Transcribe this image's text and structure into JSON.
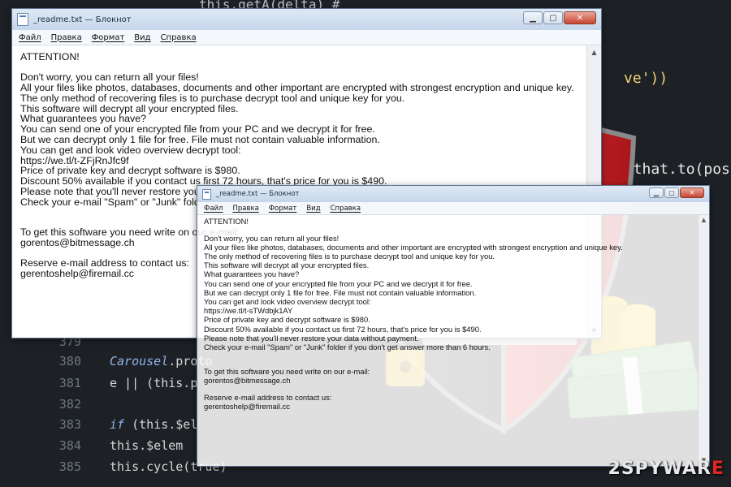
{
  "background_code": {
    "lines": [
      {
        "num": "379",
        "text": ""
      },
      {
        "num": "380",
        "text": "Carousel.proto"
      },
      {
        "num": "381",
        "text": "  e || (this.p"
      },
      {
        "num": "382",
        "text": ""
      },
      {
        "num": "383",
        "text": "  if (this.$el"
      },
      {
        "num": "384",
        "text": "    this.$elem"
      },
      {
        "num": "385",
        "text": "    this.cycle(true)"
      }
    ],
    "fragment_top": "this.getA(delta) #",
    "fragment_ve": "ve'))",
    "fragment_that": "{ that.to(pos) })"
  },
  "note_text": [
    "ATTENTION!",
    "",
    "Don't worry, you can return all your files!",
    "All your files like photos, databases, documents and other important are encrypted with strongest encryption and unique key.",
    "The only method of recovering files is to purchase decrypt tool and unique key for you.",
    "This software will decrypt all your encrypted files.",
    "What guarantees you have?",
    "You can send one of your encrypted file from your PC and we decrypt it for free.",
    "But we can decrypt only 1 file for free. File must not contain valuable information.",
    "You can get and look video overview decrypt tool:",
    "",
    "Price of private key and decrypt software is $980.",
    "Discount 50% available if you contact us first 72 hours, that's price for you is $490.",
    "Please note that you'll never restore your data without payment.",
    "Check your e-mail \"Spam\" or \"Junk\" folder if you don't get answer more than 6 hours.",
    "",
    "",
    "To get this software you need write on our e-mail:",
    "gorentos@bitmessage.ch",
    "",
    "Reserve e-mail address to contact us:",
    "gerentoshelp@firemail.cc"
  ],
  "window_back": {
    "title": "_readme.txt — Блокнот",
    "menu": [
      "Файл",
      "Правка",
      "Формат",
      "Вид",
      "Справка"
    ],
    "video_link": "https://we.tl/t-ZFjRnJfc9f"
  },
  "window_front": {
    "title": "_readme.txt — Блокнот",
    "menu": [
      "Файл",
      "Правка",
      "Формат",
      "Вид",
      "Справка"
    ],
    "video_link": "https://we.tl/t-sTWdbjk1AY"
  },
  "window_buttons": {
    "minimize": "▁",
    "maximize": "▢",
    "close": "✕"
  },
  "watermark": {
    "prefix": "2",
    "brand": "SPYWAR",
    "suffix": "E"
  },
  "colors": {
    "shield_red": "#d8222a",
    "shield_dark": "#2a2a2a",
    "coin_gold": "#f2c21b",
    "cash_green": "#6aa85a"
  }
}
